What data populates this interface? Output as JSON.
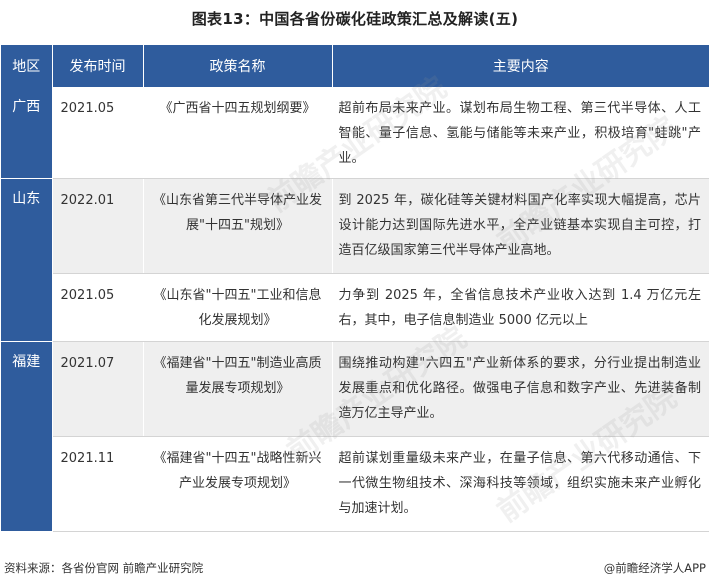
{
  "title": "图表13：中国各省份碳化硅政策汇总及解读(五)",
  "headers": [
    "地区",
    "发布时间",
    "政策名称",
    "主要内容"
  ],
  "rows": [
    {
      "region": "广西",
      "year": "2021.05",
      "policy": "《广西省十四五规划纲要》",
      "content": "超前布局未来产业。谋划布局生物工程、第三代半导体、人工智能、量子信息、氢能与储能等未来产业，积极培育\"蛙跳\"产业。"
    },
    {
      "region": "山东",
      "year": "2022.01",
      "policy": "《山东省第三代半导体产业发展\"十四五\"规划》",
      "content": "到 2025 年，碳化硅等关键材料国产化率实现大幅提高，芯片设计能力达到国际先进水平，全产业链基本实现自主可控，打造百亿级国家第三代半导体产业高地。"
    },
    {
      "region": "",
      "year": "2021.05",
      "policy": "《山东省\"十四五\"工业和信息化发展规划》",
      "content": "力争到 2025 年，全省信息技术产业收入达到 1.4 万亿元左右，其中，电子信息制造业 5000 亿元以上"
    },
    {
      "region": "福建",
      "year": "2021.07",
      "policy": "《福建省\"十四五\"制造业高质量发展专项规划》",
      "content": "围绕推动构建\"六四五\"产业新体系的要求，分行业提出制造业发展重点和优化路径。做强电子信息和数字产业、先进装备制造万亿主导产业。"
    },
    {
      "region": "",
      "year": "2021.11",
      "policy": "《福建省\"十四五\"战略性新兴产业发展专项规划》",
      "content": "超前谋划重量级未来产业，在量子信息、第六代移动通信、下一代微生物组技术、深海科技等领域，组织实施未来产业孵化与加速计划。"
    }
  ],
  "footer": {
    "source": "资料来源：各省份官网 前瞻产业研究院",
    "brand": "@前瞻经济学人APP"
  },
  "watermark": "前瞻产业研究院",
  "colors": {
    "header_bg": "#2f5c9d",
    "row_gray": "#efefef"
  }
}
